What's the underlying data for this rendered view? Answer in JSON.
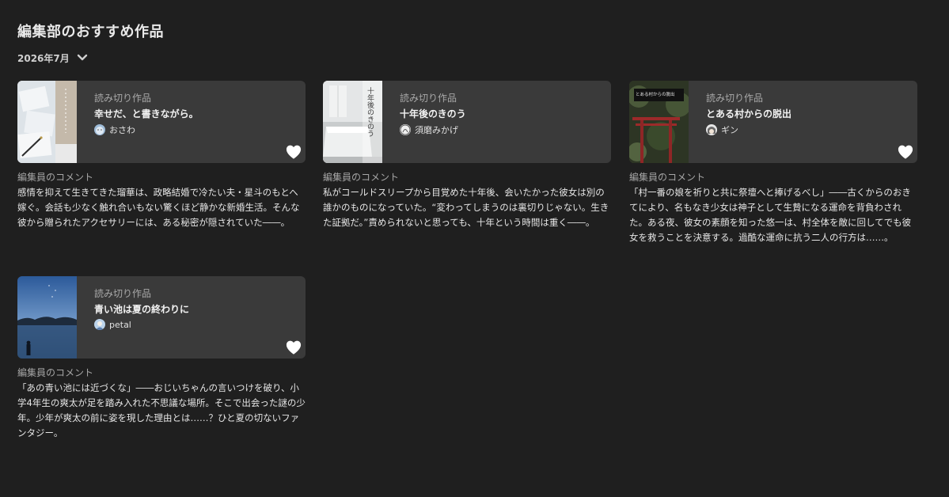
{
  "page": {
    "title": "編集部のおすすめ作品",
    "month": "2026年7月"
  },
  "comment_label": "編集員のコメント",
  "entries": [
    {
      "type": "読み切り作品",
      "title": "幸せだ、と書きながら。",
      "author": "おさわ",
      "comment": "感情を抑えて生きてきた瑠華は、政略結婚で冷たい夫・星斗のもとへ嫁ぐ。会話も少なく触れ合いもない驚くほど静かな新婚生活。そんな彼から贈られたアクセサリーには、ある秘密が隠されていた――。"
    },
    {
      "type": "読み切り作品",
      "title": "十年後のきのう",
      "author": "須磨みかげ",
      "cover_text": "十年後のきのう",
      "comment": "私がコールドスリープから目覚めた十年後、会いたかった彼女は別の誰かのものになっていた。“変わってしまうのは裏切りじゃない。生きた証拠だ。”責められないと思っても、十年という時間は重く――。"
    },
    {
      "type": "読み切り作品",
      "title": "とある村からの脱出",
      "author": "ギン",
      "cover_text": "とある村からの脱出",
      "comment": "「村一番の娘を祈りと共に祭壇へと捧げるべし」――古くからのおきてにより、名もなき少女は神子として生贄になる運命を背負わされた。ある夜、彼女の素顔を知った悠一は、村全体を敵に回してでも彼女を救うことを決意する。過酷な運命に抗う二人の行方は……。"
    },
    {
      "type": "読み切り作品",
      "title": "青い池は夏の終わりに",
      "author": "petal",
      "comment": "「あの青い池には近づくな」――おじいちゃんの言いつけを破り、小学4年生の爽太が足を踏み入れた不思議な場所。そこで出会った謎の少年。少年が爽太の前に姿を現した理由とは……？ひと夏の切ないファンタジー。"
    }
  ],
  "colors": {
    "background": "#1f1f1f",
    "card": "#3a3a3a",
    "muted_text": "#a6a6a6",
    "like_icon": "#ffffff"
  },
  "icons": {
    "month_toggle": "chevron-down-icon",
    "like": "heart-icon"
  }
}
